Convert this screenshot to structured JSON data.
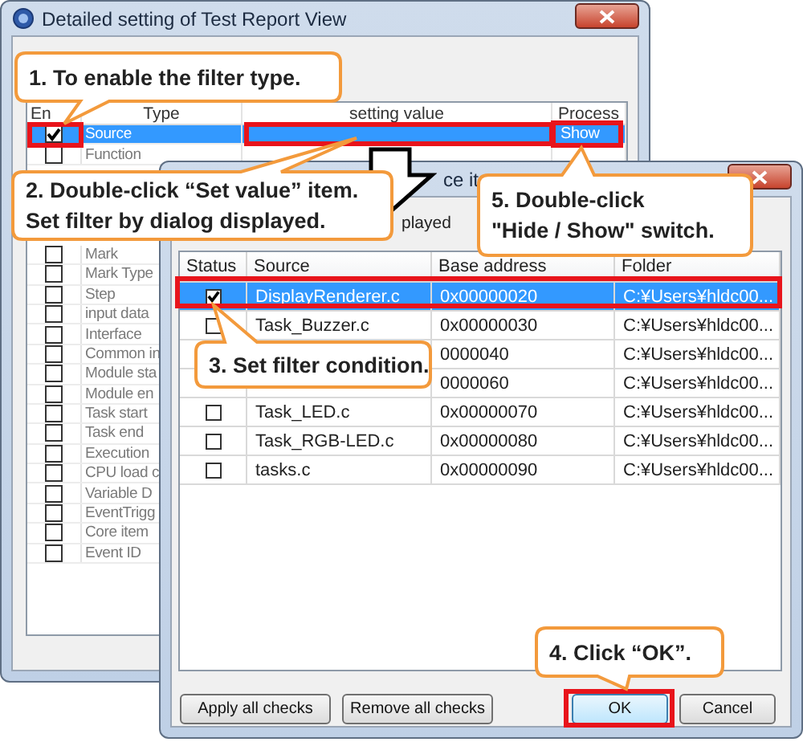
{
  "filter_window": {
    "title": "Detailed setting of Test Report View",
    "columns": [
      "En",
      "Type",
      "setting value",
      "Process"
    ],
    "rows": [
      {
        "type": "Source",
        "process": "Show",
        "checked": true,
        "selected": true
      },
      {
        "type": "Function",
        "checked": false,
        "selected": false
      },
      {
        "type": "Mark",
        "checked": false,
        "selected": false
      },
      {
        "type": "Mark Type",
        "checked": false,
        "selected": false
      },
      {
        "type": "Step",
        "checked": false,
        "selected": false
      },
      {
        "type": "input data",
        "checked": false,
        "selected": false
      },
      {
        "type": "Interface",
        "checked": false,
        "selected": false
      },
      {
        "type": "Common in",
        "checked": false,
        "selected": false
      },
      {
        "type": "Module sta",
        "checked": false,
        "selected": false
      },
      {
        "type": "Module en",
        "checked": false,
        "selected": false
      },
      {
        "type": "Task start",
        "checked": false,
        "selected": false
      },
      {
        "type": "Task end",
        "checked": false,
        "selected": false
      },
      {
        "type": "Execution",
        "checked": false,
        "selected": false
      },
      {
        "type": "CPU load c",
        "checked": false,
        "selected": false
      },
      {
        "type": "Variable D",
        "checked": false,
        "selected": false
      },
      {
        "type": "EventTrigg",
        "checked": false,
        "selected": false
      },
      {
        "type": "Core item",
        "checked": false,
        "selected": false
      },
      {
        "type": "Event ID",
        "checked": false,
        "selected": false
      }
    ]
  },
  "source_window": {
    "title": "ce it",
    "label": "played",
    "columns": [
      "Status",
      "Source",
      "Base address",
      "Folder"
    ],
    "rows": [
      {
        "source": "DisplayRenderer.c",
        "base_address": "0x00000020",
        "folder": "C:¥Users¥hldc00...",
        "checked": true,
        "selected": true
      },
      {
        "source": "Task_Buzzer.c",
        "base_address": "0x00000030",
        "folder": "C:¥Users¥hldc00...",
        "checked": false,
        "selected": false
      },
      {
        "base_address": "0000040",
        "folder": "C:¥Users¥hldc00...",
        "selected": false
      },
      {
        "base_address": "0000060",
        "folder": "C:¥Users¥hldc00...",
        "selected": false
      },
      {
        "source": "Task_LED.c",
        "base_address": "0x00000070",
        "folder": "C:¥Users¥hldc00...",
        "checked": false,
        "selected": false
      },
      {
        "source": "Task_RGB-LED.c",
        "base_address": "0x00000080",
        "folder": "C:¥Users¥hldc00...",
        "checked": false,
        "selected": false
      },
      {
        "source": "tasks.c",
        "base_address": "0x00000090",
        "folder": "C:¥Users¥hldc00...",
        "checked": false,
        "selected": false
      }
    ],
    "buttons": [
      {
        "label": "Apply all checks",
        "default": false
      },
      {
        "label": "Remove all checks",
        "default": false
      },
      {
        "label": "OK",
        "default": true
      },
      {
        "label": "Cancel",
        "default": false
      }
    ]
  },
  "callouts": [
    {
      "text": "1. To enable the filter type."
    },
    {
      "text": "2. Double-click “Set value” item.\nSet filter by dialog displayed."
    },
    {
      "text": "5. Double-click\n\"Hide / Show\" switch."
    },
    {
      "text": "3. Set filter condition."
    },
    {
      "text": "4. Click “OK”."
    }
  ]
}
